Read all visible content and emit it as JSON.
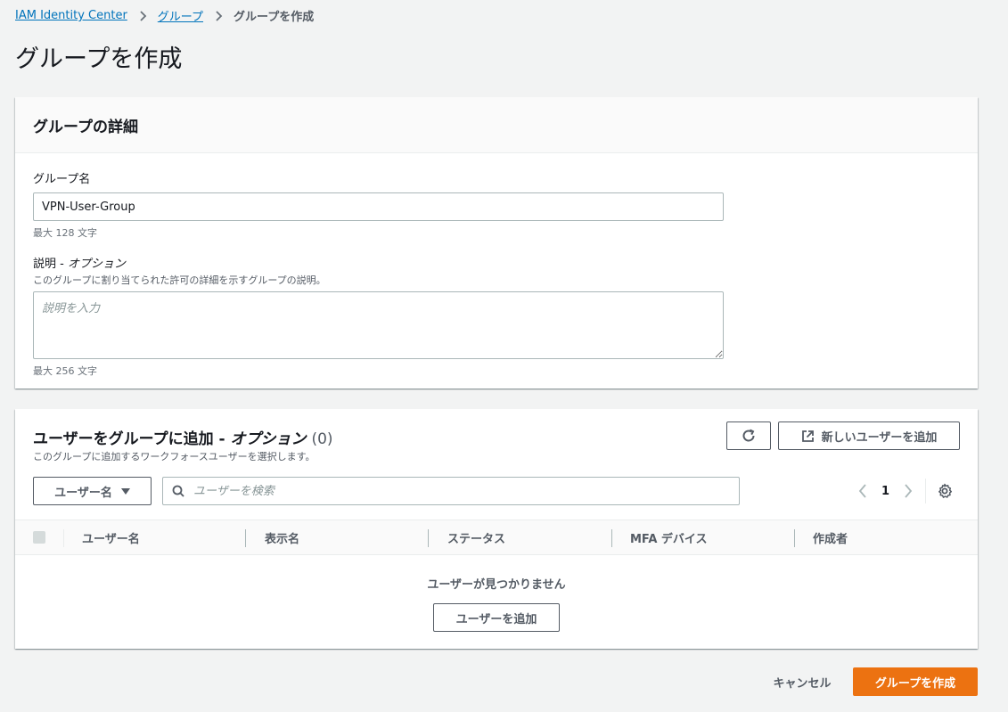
{
  "breadcrumb": {
    "items": [
      "IAM Identity Center",
      "グループ"
    ],
    "current": "グループを作成"
  },
  "page_title": "グループを作成",
  "details_panel": {
    "title": "グループの詳細",
    "name_label": "グループ名",
    "name_value": "VPN-User-Group",
    "name_constraint": "最大 128 文字",
    "desc_label": "説明 - ",
    "desc_label_opt": "オプション",
    "desc_hint": "このグループに割り当てられた許可の詳細を示すグループの説明。",
    "desc_placeholder": "説明を入力",
    "desc_constraint": "最大 256 文字"
  },
  "users_panel": {
    "title": "ユーザーをグループに追加 - ",
    "title_opt": "オプション",
    "count": "(0)",
    "description": "このグループに追加するワークフォースユーザーを選択します。",
    "new_user_button": "新しいユーザーを追加",
    "filter_select": "ユーザー名",
    "search_placeholder": "ユーザーを検索",
    "page_number": "1",
    "columns": [
      "ユーザー名",
      "表示名",
      "ステータス",
      "MFA デバイス",
      "作成者"
    ],
    "empty_text": "ユーザーが見つかりません",
    "add_user_button": "ユーザーを追加"
  },
  "footer": {
    "cancel": "キャンセル",
    "create": "グループを作成"
  },
  "colors": {
    "link": "#0073bb",
    "primary": "#ec7211",
    "text": "#16191f",
    "secondary_text": "#545b64",
    "background": "#f2f3f3"
  },
  "icons": [
    "chevron-right-icon",
    "refresh-icon",
    "external-link-icon",
    "search-icon",
    "chevron-left-icon",
    "settings-gear-icon",
    "caret-down-icon"
  ]
}
